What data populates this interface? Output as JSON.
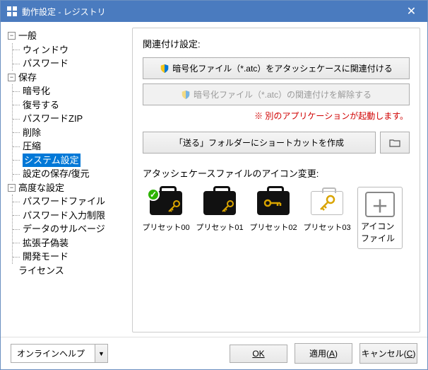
{
  "title": "動作設定 - レジストリ",
  "tree": {
    "general": {
      "label": "一般",
      "window": "ウィンドウ",
      "password": "パスワード"
    },
    "save": {
      "label": "保存",
      "encrypt": "暗号化",
      "decrypt": "復号する",
      "pwdzip": "パスワードZIP",
      "delete": "削除",
      "compress": "圧縮",
      "system": "システム設定",
      "saverestore": "設定の保存/復元"
    },
    "advanced": {
      "label": "高度な設定",
      "pwdfile": "パスワードファイル",
      "pwdinput": "パスワード入力制限",
      "salvage": "データのサルベージ",
      "extfake": "拡張子偽装",
      "devmode": "開発モード"
    },
    "license": "ライセンス"
  },
  "panel": {
    "heading1": "関連付け設定:",
    "btn_assoc": "暗号化ファイル（*.atc）をアタッシェケースに関連付ける",
    "btn_unassoc": "暗号化ファイル（*.atc）の関連付けを解除する",
    "warn": "※ 別のアプリケーションが起動します。",
    "btn_sendto": "「送る」フォルダーにショートカットを作成",
    "heading2": "アタッシェケースファイルのアイコン変更:",
    "preset0": "プリセット00",
    "preset1": "プリセット01",
    "preset2": "プリセット02",
    "preset3": "プリセット03",
    "iconfile": "アイコンファイル"
  },
  "footer": {
    "help": "オンラインヘルプ",
    "ok": "OK",
    "apply_pre": "適用(",
    "apply_u": "A",
    "apply_post": ")",
    "cancel_pre": "キャンセル(",
    "cancel_u": "C",
    "cancel_post": ")"
  }
}
